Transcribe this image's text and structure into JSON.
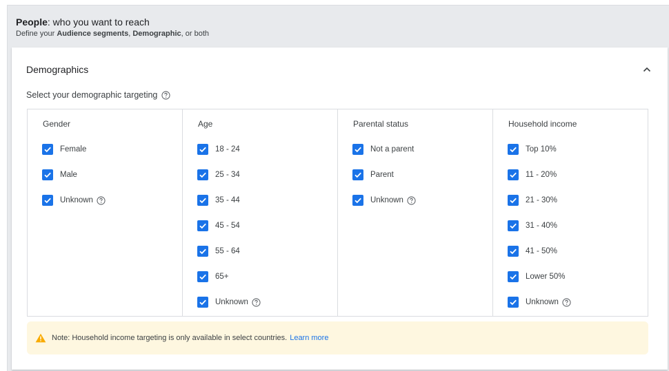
{
  "header": {
    "title_bold": "People",
    "title_rest": ": who you want to reach",
    "sub_prefix": "Define your ",
    "sub_bold1": "Audience segments",
    "sub_comma": ", ",
    "sub_bold2": "Demographic",
    "sub_suffix": ", or both"
  },
  "card": {
    "title": "Demographics",
    "subtitle": "Select your demographic targeting"
  },
  "columns": [
    {
      "heading": "Gender",
      "options": [
        {
          "label": "Female",
          "checked": true
        },
        {
          "label": "Male",
          "checked": true
        },
        {
          "label": "Unknown",
          "checked": true,
          "help": true
        }
      ]
    },
    {
      "heading": "Age",
      "options": [
        {
          "label": "18 - 24",
          "checked": true
        },
        {
          "label": "25 - 34",
          "checked": true
        },
        {
          "label": "35 - 44",
          "checked": true
        },
        {
          "label": "45 - 54",
          "checked": true
        },
        {
          "label": "55 - 64",
          "checked": true
        },
        {
          "label": "65+",
          "checked": true
        },
        {
          "label": "Unknown",
          "checked": true,
          "help": true
        }
      ]
    },
    {
      "heading": "Parental status",
      "options": [
        {
          "label": "Not a parent",
          "checked": true
        },
        {
          "label": "Parent",
          "checked": true
        },
        {
          "label": "Unknown",
          "checked": true,
          "help": true
        }
      ]
    },
    {
      "heading": "Household income",
      "options": [
        {
          "label": "Top 10%",
          "checked": true
        },
        {
          "label": "11 - 20%",
          "checked": true
        },
        {
          "label": "21 - 30%",
          "checked": true
        },
        {
          "label": "31 - 40%",
          "checked": true
        },
        {
          "label": "41 - 50%",
          "checked": true
        },
        {
          "label": "Lower 50%",
          "checked": true
        },
        {
          "label": "Unknown",
          "checked": true,
          "help": true
        }
      ]
    }
  ],
  "note": {
    "text": "Note: Household income targeting is only available in select countries.",
    "link": "Learn more"
  },
  "colors": {
    "checkbox": "#1a73e8",
    "link": "#1a73e8",
    "warning": "#f9ab00",
    "note_bg": "#fef7e0"
  },
  "icons": {
    "collapse": "chevron-up-icon",
    "help": "help-circle-icon",
    "warning": "warning-triangle-icon",
    "check": "check-icon"
  }
}
